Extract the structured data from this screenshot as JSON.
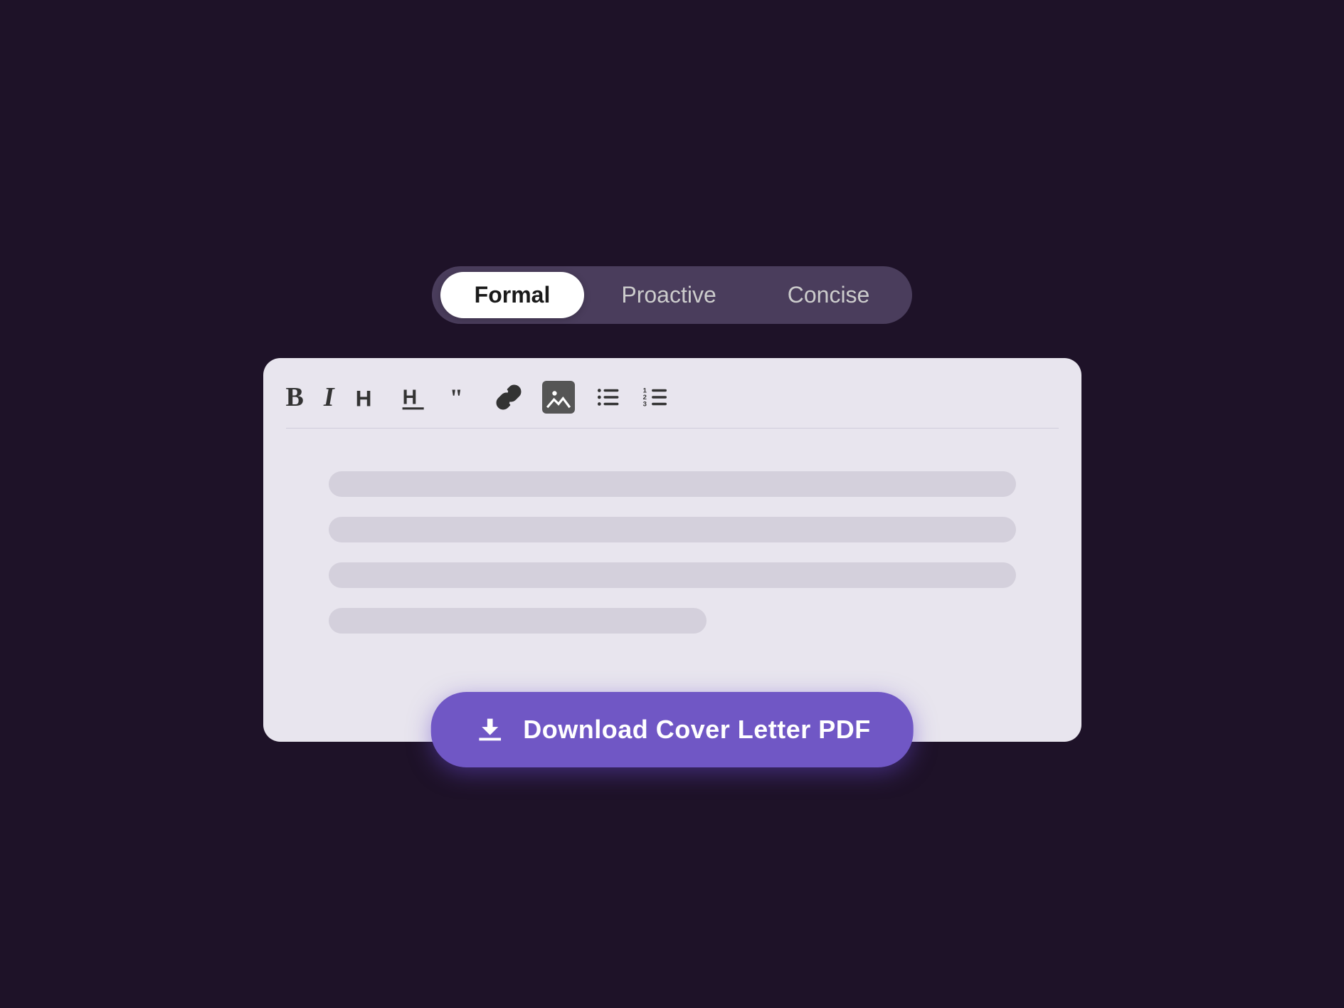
{
  "background_color": "#1e1228",
  "toggle": {
    "options": [
      {
        "id": "formal",
        "label": "Formal",
        "active": true
      },
      {
        "id": "proactive",
        "label": "Proactive",
        "active": false
      },
      {
        "id": "concise",
        "label": "Concise",
        "active": false
      }
    ]
  },
  "editor": {
    "toolbar": {
      "buttons": [
        {
          "id": "bold",
          "symbol": "B",
          "label": "bold-button"
        },
        {
          "id": "italic",
          "symbol": "I",
          "label": "italic-button"
        },
        {
          "id": "h1",
          "symbol": "H",
          "label": "heading1-button"
        },
        {
          "id": "h2",
          "symbol": "H",
          "label": "heading2-button"
        },
        {
          "id": "quote",
          "symbol": "“”",
          "label": "quote-button"
        }
      ]
    },
    "skeleton_lines": [
      {
        "id": "line1",
        "width": "full"
      },
      {
        "id": "line2",
        "width": "full"
      },
      {
        "id": "line3",
        "width": "full"
      },
      {
        "id": "line4",
        "width": "short"
      }
    ]
  },
  "download_button": {
    "label": "Download Cover Letter PDF"
  }
}
